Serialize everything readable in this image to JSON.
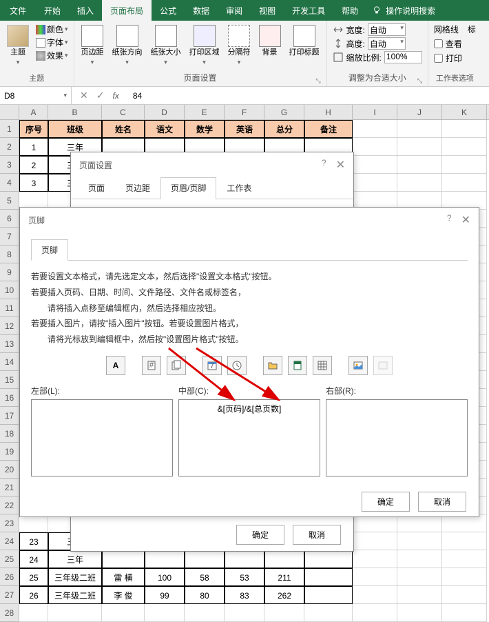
{
  "ribbon": {
    "tabs": [
      "文件",
      "开始",
      "插入",
      "页面布局",
      "公式",
      "数据",
      "审阅",
      "视图",
      "开发工具",
      "帮助"
    ],
    "active_tab": "页面布局",
    "search_placeholder": "操作说明搜索",
    "groups": {
      "theme": {
        "label": "主题",
        "main_btn": "主题",
        "colors": "颜色",
        "fonts": "字体",
        "effects": "效果"
      },
      "page_setup": {
        "label": "页面设置",
        "margins": "页边距",
        "orientation": "纸张方向",
        "size": "纸张大小",
        "print_area": "打印区域",
        "breaks": "分隔符",
        "background": "背景",
        "print_titles": "打印标题"
      },
      "scale": {
        "label": "调整为合适大小",
        "width_label": "宽度:",
        "width_value": "自动",
        "height_label": "高度:",
        "height_value": "自动",
        "scale_label": "缩放比例:",
        "scale_value": "100%"
      },
      "gridlines": {
        "label_grid": "网格线",
        "view": "查看",
        "print": "打印",
        "sheet_label": "工作表选项",
        "headings_label": "标"
      }
    }
  },
  "formula_bar": {
    "name_box": "D8",
    "formula": "84"
  },
  "grid": {
    "columns": [
      "A",
      "B",
      "C",
      "D",
      "E",
      "F",
      "G",
      "H",
      "I",
      "J",
      "K"
    ],
    "header_row": [
      "序号",
      "班级",
      "姓名",
      "语文",
      "数学",
      "英语",
      "总分",
      "备注"
    ],
    "rows": [
      {
        "n": 1,
        "cells": [
          "1",
          "三年",
          "",
          "",
          "",
          "",
          "",
          ""
        ]
      },
      {
        "n": 2,
        "cells": [
          "2",
          "三年",
          "",
          "",
          "",
          "",
          "",
          ""
        ]
      },
      {
        "n": 3,
        "cells": [
          "3",
          "三年",
          "",
          "",
          "",
          "",
          "",
          ""
        ]
      },
      {
        "n": 4,
        "cells": [
          "",
          "",
          "",
          "",
          "",
          "",
          "",
          ""
        ]
      },
      {
        "n": 5,
        "cells": [
          "",
          "",
          "",
          "",
          "",
          "",
          "",
          ""
        ]
      },
      {
        "n": 6,
        "cells": [
          "",
          "",
          "",
          "",
          "",
          "",
          "",
          ""
        ]
      },
      {
        "n": 7,
        "cells": [
          "",
          "",
          "",
          "",
          "",
          "",
          "",
          ""
        ]
      },
      {
        "n": 8,
        "cells": [
          "",
          "",
          "",
          "",
          "",
          "",
          "",
          ""
        ]
      },
      {
        "n": 9,
        "cells": [
          "",
          "",
          "",
          "",
          "",
          "",
          "",
          ""
        ]
      },
      {
        "n": 10,
        "cells": [
          "",
          "",
          "",
          "",
          "",
          "",
          "",
          ""
        ]
      },
      {
        "n": 11,
        "cells": [
          "",
          "",
          "",
          "",
          "",
          "",
          "",
          ""
        ]
      },
      {
        "n": 12,
        "cells": [
          "",
          "",
          "",
          "",
          "",
          "",
          "",
          ""
        ]
      },
      {
        "n": 13,
        "cells": [
          "",
          "",
          "",
          "",
          "",
          "",
          "",
          ""
        ]
      },
      {
        "n": 14,
        "cells": [
          "",
          "",
          "",
          "",
          "",
          "",
          "",
          ""
        ]
      },
      {
        "n": 15,
        "cells": [
          "",
          "",
          "",
          "",
          "",
          "",
          "",
          ""
        ]
      },
      {
        "n": 16,
        "cells": [
          "",
          "",
          "",
          "",
          "",
          "",
          "",
          ""
        ]
      },
      {
        "n": 17,
        "cells": [
          "",
          "",
          "",
          "",
          "",
          "",
          "",
          ""
        ]
      },
      {
        "n": 18,
        "cells": [
          "",
          "",
          "",
          "",
          "",
          "",
          "",
          ""
        ]
      },
      {
        "n": 19,
        "cells": [
          "",
          "",
          "",
          "",
          "",
          "",
          "",
          ""
        ]
      },
      {
        "n": 20,
        "cells": [
          "",
          "",
          "",
          "",
          "",
          "",
          "",
          ""
        ]
      },
      {
        "n": 21,
        "cells": [
          "",
          "",
          "",
          "",
          "",
          "",
          "",
          ""
        ]
      },
      {
        "n": 22,
        "cells": [
          "",
          "",
          "",
          "",
          "",
          "",
          "",
          ""
        ]
      },
      {
        "n": 23,
        "cells": [
          "23",
          "三年",
          "",
          "",
          "",
          "",
          "",
          ""
        ]
      },
      {
        "n": 24,
        "cells": [
          "24",
          "三年",
          "",
          "",
          "",
          "",
          "",
          ""
        ]
      },
      {
        "n": 25,
        "cells": [
          "25",
          "三年级二班",
          "雷   横",
          "100",
          "58",
          "53",
          "211",
          ""
        ]
      },
      {
        "n": 26,
        "cells": [
          "26",
          "三年级二班",
          "李   俊",
          "99",
          "80",
          "83",
          "262",
          ""
        ]
      },
      {
        "n": 27,
        "cells": [
          "",
          "",
          "",
          "",
          "",
          "",
          "",
          ""
        ]
      }
    ]
  },
  "page_setup_dialog": {
    "title": "页面设置",
    "tabs": [
      "页面",
      "页边距",
      "页眉/页脚",
      "工作表"
    ],
    "active_tab": "页眉/页脚",
    "ok": "确定",
    "cancel": "取消"
  },
  "footer_dialog": {
    "title": "页脚",
    "tab": "页脚",
    "help": {
      "line1": "若要设置文本格式，请先选定文本，然后选择\"设置文本格式\"按钮。",
      "line2": "若要插入页码、日期、时间、文件路径、文件名或标签名，",
      "line3": "请将插入点移至编辑框内，然后选择相应按钮。",
      "line4": "若要插入图片，请按\"插入图片\"按钮。若要设置图片格式，",
      "line5": "请将光标放到编辑框中，然后按\"设置图片格式\"按钮。"
    },
    "left_label": "左部(L):",
    "center_label": "中部(C):",
    "right_label": "右部(R):",
    "center_content": "&[页码]/&[总页数]",
    "ok": "确定",
    "cancel": "取消",
    "toolbar_icons": [
      "format-text-icon",
      "page-number-icon",
      "pages-icon",
      "date-icon",
      "time-icon",
      "file-path-icon",
      "file-name-icon",
      "sheet-name-icon",
      "insert-picture-icon",
      "format-picture-icon"
    ]
  }
}
